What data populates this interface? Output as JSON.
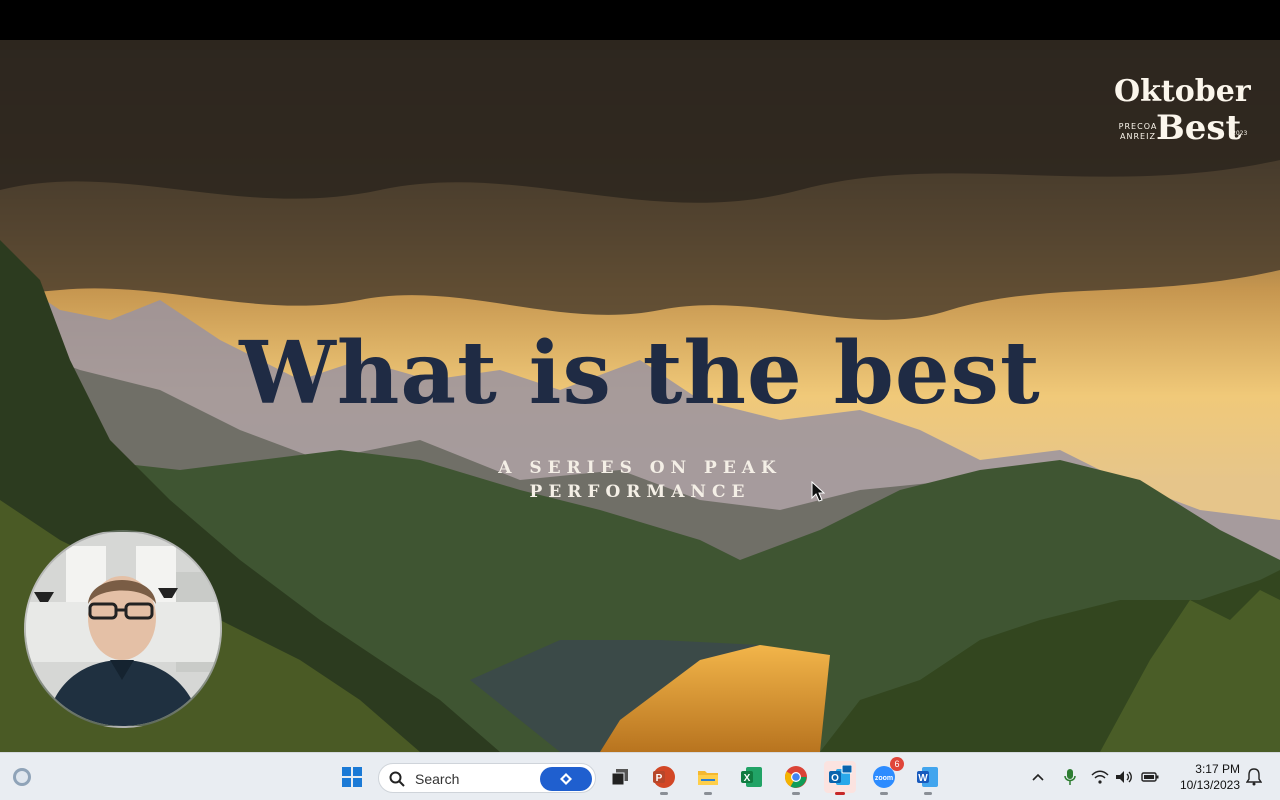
{
  "slide": {
    "title": "What is the best",
    "subtitle_line1": "A SERIES ON PEAK",
    "subtitle_line2": "PERFORMANCE",
    "logo": {
      "line1": "Oktober",
      "line2": "Best",
      "small": "PRECOA ANREIZ",
      "year": "2023"
    }
  },
  "taskbar": {
    "search_label": "Search",
    "apps": [
      {
        "name": "powerpoint",
        "icon": "powerpoint-icon"
      },
      {
        "name": "file-explorer",
        "icon": "folder-icon"
      },
      {
        "name": "excel",
        "icon": "excel-icon"
      },
      {
        "name": "chrome",
        "icon": "chrome-icon"
      },
      {
        "name": "outlook",
        "icon": "outlook-icon"
      },
      {
        "name": "zoom",
        "icon": "zoom-icon",
        "badge": "6"
      },
      {
        "name": "word",
        "icon": "word-icon"
      }
    ],
    "clock": {
      "time": "3:17 PM",
      "date": "10/13/2023"
    }
  },
  "colors": {
    "title": "#1f2b44",
    "subtitle": "#f4efe6",
    "taskbar": "#e9edf2",
    "accent": "#1f5fcf"
  }
}
